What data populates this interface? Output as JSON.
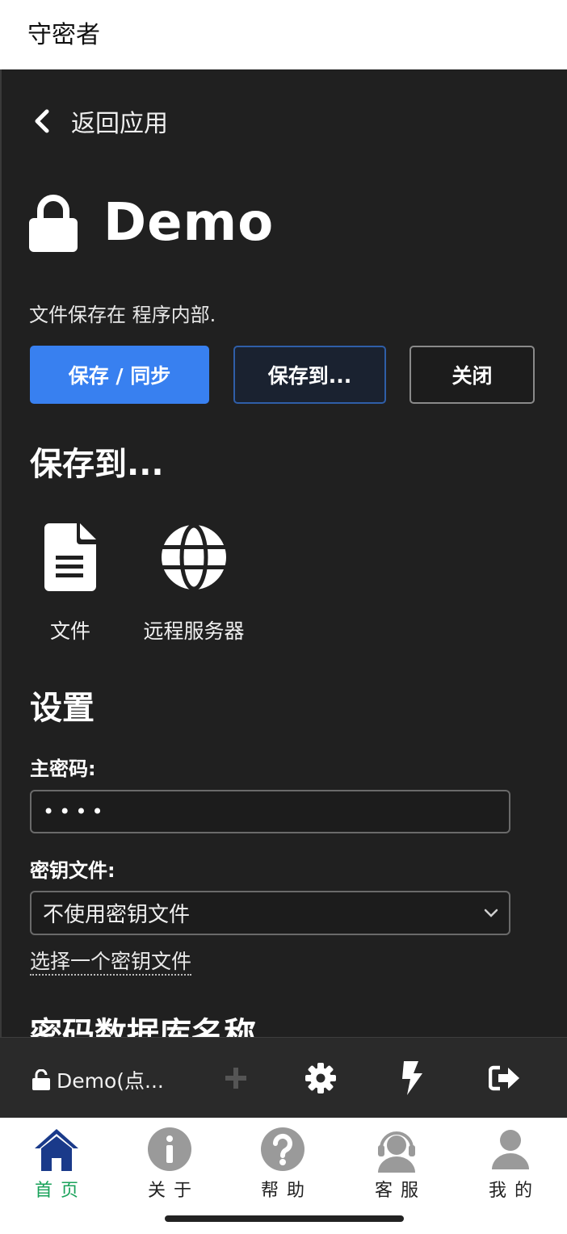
{
  "app": {
    "title": "守密者"
  },
  "header": {
    "back_label": "返回应用"
  },
  "database": {
    "name": "Demo",
    "saved_info": "文件保存在 程序内部."
  },
  "actions": {
    "save_sync": "保存 / 同步",
    "save_to": "保存到...",
    "close": "关闭"
  },
  "save_to_section": {
    "heading": "保存到...",
    "options": [
      {
        "label": "文件",
        "icon": "file-icon"
      },
      {
        "label": "远程服务器",
        "icon": "globe-icon"
      }
    ]
  },
  "settings": {
    "heading": "设置",
    "master_password_label": "主密码:",
    "master_password_value": "••••",
    "keyfile_label": "密钥文件:",
    "keyfile_selected": "不使用密钥文件",
    "choose_keyfile_link": "选择一个密钥文件",
    "db_name_heading": "密码数据库名称"
  },
  "toolbar": {
    "db_label": "Demo(点...",
    "icons": [
      "unlock-icon",
      "plus-icon",
      "gear-icon",
      "bolt-icon",
      "sign-out-icon"
    ]
  },
  "bottom_nav": {
    "items": [
      {
        "label": "首页",
        "icon": "home-icon",
        "active": true
      },
      {
        "label": "关于",
        "icon": "info-icon"
      },
      {
        "label": "帮助",
        "icon": "question-icon"
      },
      {
        "label": "客服",
        "icon": "headset-user-icon"
      },
      {
        "label": "我的",
        "icon": "user-icon"
      }
    ]
  },
  "colors": {
    "primary": "#3880f0",
    "panel_bg": "#202020",
    "toolbar_bg": "#2a2a2a",
    "nav_active": "#19a25a",
    "home_icon": "#1a3a8a"
  }
}
